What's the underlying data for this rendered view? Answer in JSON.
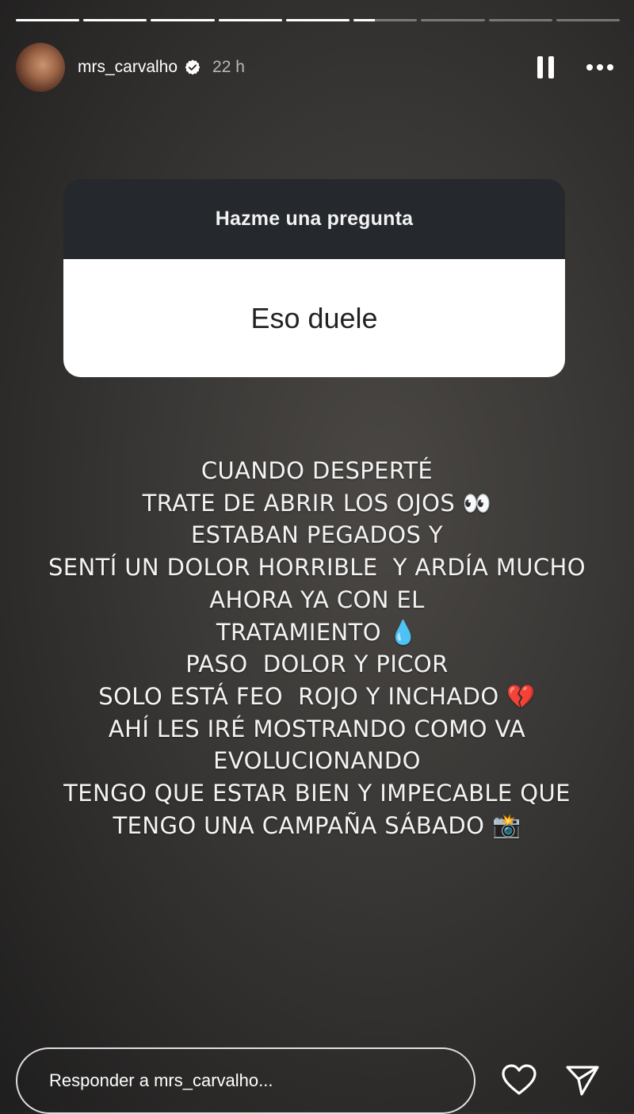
{
  "progress": {
    "segments": 9,
    "completed": 5,
    "current_fill": 0.34
  },
  "header": {
    "username": "mrs_carvalho",
    "time": "22 h",
    "verified": true,
    "icons": [
      "verified-icon",
      "pause-icon",
      "more-icon"
    ]
  },
  "question_sticker": {
    "prompt": "Hazme una pregunta",
    "answer": "Eso duele"
  },
  "story_text": [
    "CUANDO DESPERTÉ",
    "TRATE DE ABRIR LOS OJOS 👀",
    "ESTABAN PEGADOS Y",
    "SENTÍ UN DOLOR HORRIBLE  Y ARDÍA MUCHO",
    "AHORA YA CON EL",
    "TRATAMIENTO 💧",
    "PASO  DOLOR Y PICOR",
    "SOLO ESTÁ FEO  ROJO Y INCHADO 💔",
    "AHÍ LES IRÉ MOSTRANDO COMO VA",
    "EVOLUCIONANDO",
    "TENGO QUE ESTAR BIEN Y IMPECABLE QUE",
    "TENGO UNA CAMPAÑA SÁBADO 📸"
  ],
  "footer": {
    "reply_placeholder": "Responder a mrs_carvalho...",
    "icons": [
      "heart-icon",
      "send-icon"
    ]
  },
  "colors": {
    "background": "#353331",
    "sticker_header": "#25282c",
    "sticker_body": "#ffffff",
    "verified_badge": "#ffffff"
  }
}
